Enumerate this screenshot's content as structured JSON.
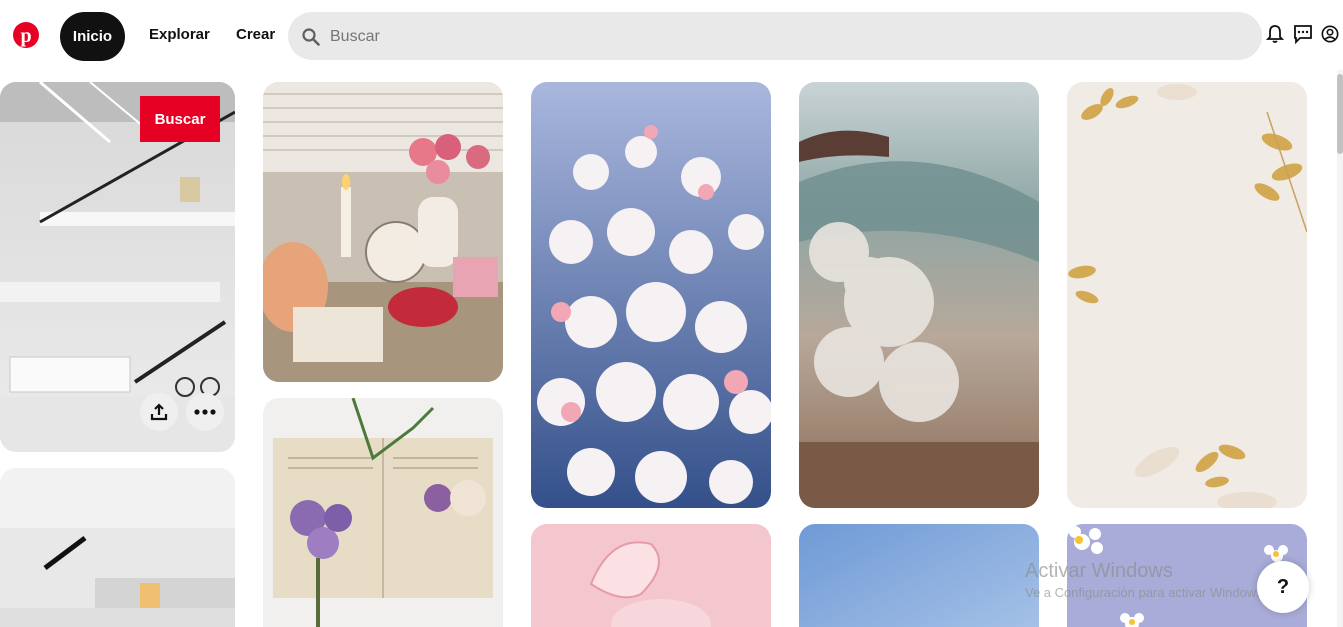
{
  "header": {
    "logo_icon": "pinterest-logo-icon",
    "nav": {
      "home_label": "Inicio",
      "explore_label": "Explorar",
      "create_label": "Crear"
    },
    "search": {
      "placeholder": "Buscar",
      "icon": "search-icon"
    },
    "icons": [
      "bell-icon",
      "chat-icon",
      "profile-icon"
    ]
  },
  "pins": [
    {
      "subject": "interior-staircase",
      "save_label": "Buscar",
      "actions": [
        "share-icon",
        "more-icon"
      ]
    },
    {
      "subject": "bedroom-nightstand"
    },
    {
      "subject": "white-roses"
    },
    {
      "subject": "ocean-wave"
    },
    {
      "subject": "gold-leaves-frame"
    },
    {
      "subject": "white-interior"
    },
    {
      "subject": "book-with-flowers"
    },
    {
      "subject": "pink-illustration"
    },
    {
      "subject": "blue-sky"
    },
    {
      "subject": "daisies-lavender"
    }
  ],
  "watermark": {
    "title": "Activar Windows",
    "subtitle": "Ve a Configuración para activar Windows."
  },
  "help": {
    "label": "?"
  },
  "colors": {
    "brand": "#e60023",
    "pill": "#111111",
    "search_bg": "#e9e9e9"
  }
}
